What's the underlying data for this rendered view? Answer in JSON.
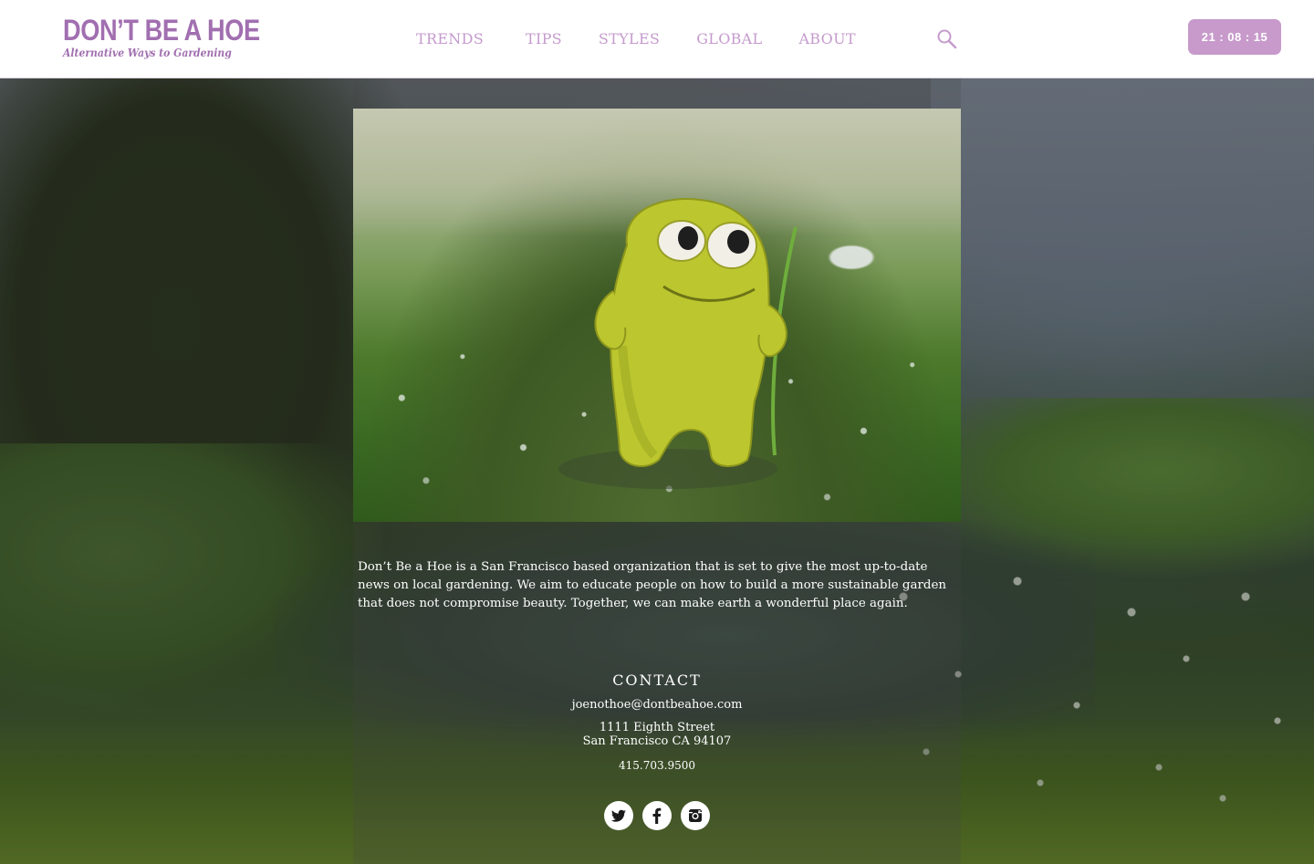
{
  "brand": {
    "title": "DON’T BE A HOE",
    "tagline": "Alternative Ways to Gardening",
    "accent_color": "#a16fb0",
    "nav_color": "#c59bcd"
  },
  "nav": {
    "items": [
      {
        "label": "TRENDS"
      },
      {
        "label": "TIPS"
      },
      {
        "label": "STYLES"
      },
      {
        "label": "GLOBAL"
      },
      {
        "label": "ABOUT"
      }
    ],
    "search_icon": "search-icon"
  },
  "clock": {
    "time": "21 : 08 : 15",
    "background_color": "#c79acb"
  },
  "hero": {
    "image_subject": "yellow clay monster figure standing on mossy ground holding a grass blade"
  },
  "about": {
    "text": "Don’t Be a Hoe is a San Francisco based organization that is set to give the most up-to-date news on local gardening. We aim to educate people on how to build a more sustainable garden that does not compromise beauty. Together, we can make earth a wonderful place again."
  },
  "contact": {
    "title": "CONTACT",
    "email": "joenothoe@dontbeahoe.com",
    "address_line1": "1111 Eighth Street",
    "address_line2": "San Francisco CA 94107",
    "phone": "415.703.9500"
  },
  "social": {
    "items": [
      {
        "icon": "twitter-icon"
      },
      {
        "icon": "facebook-icon"
      },
      {
        "icon": "instagram-icon"
      }
    ]
  }
}
